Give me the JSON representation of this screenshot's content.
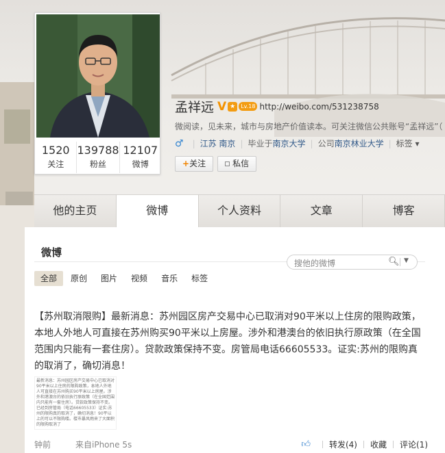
{
  "profile": {
    "name": "孟祥远",
    "verified_mark": "V",
    "level_badge": "Lv.18",
    "url": "http://weibo.com/531238758",
    "bio": "微阅读，见未来，城市与房地产价值读本。可关注微信公共账号“孟祥远”（",
    "gender_symbol": "♂",
    "location": "江苏 南京",
    "education_prefix": "毕业于",
    "education": "南京大学",
    "company_prefix": "公司",
    "company": "南京林业大学",
    "tags_label": "标签 ▾",
    "follow_label": "关注",
    "message_label": "私信"
  },
  "stats": [
    {
      "value": "1520",
      "label": "关注"
    },
    {
      "value": "139788",
      "label": "粉丝"
    },
    {
      "value": "12107",
      "label": "微博"
    }
  ],
  "tabs": [
    {
      "label": "他的主页",
      "active": false
    },
    {
      "label": "微博",
      "active": true
    },
    {
      "label": "个人资料",
      "active": false
    },
    {
      "label": "文章",
      "active": false
    },
    {
      "label": "博客",
      "active": false
    }
  ],
  "feed": {
    "title": "微博",
    "search_placeholder": "搜他的微博",
    "filters": [
      "全部",
      "原创",
      "图片",
      "视频",
      "音乐",
      "标签"
    ],
    "active_filter": "全部"
  },
  "post": {
    "text": "【苏州取消限购】最新消息：苏州园区房产交易中心已取消对90平米以上住房的限购政策，本地人外地人可直接在苏州购买90平米以上房屋。涉外和港澳台的依旧执行原政策（在全国范围内只能有一套住房）。贷款政策保持不变。房管局电话66605533。证实:苏州的限购真的取消了，确切消息！",
    "image_text": "最新消息：苏州园区房产交易中心已取消对90平米以上住房的限购政策，本地人外地人可直接在苏州购买90平米以上房屋。涉外和港澳台的依旧执行原政策（在全国范围内只能有一套住房）。贷款政策保持不变。已经到房管局（电话66605533）证实:苏州的限购真的取消了，确切消息！90平以上的可以不限购喽。楼市暴风雨来了大面积的限购取消了",
    "time": "钟前",
    "source": "来自iPhone 5s",
    "repost": "转发(4)",
    "favorite": "收藏",
    "comment": "评论(1)"
  },
  "colors": {
    "accent_orange": "#f39200",
    "link_blue": "#335a8a",
    "gender_blue": "#2e82d0"
  }
}
